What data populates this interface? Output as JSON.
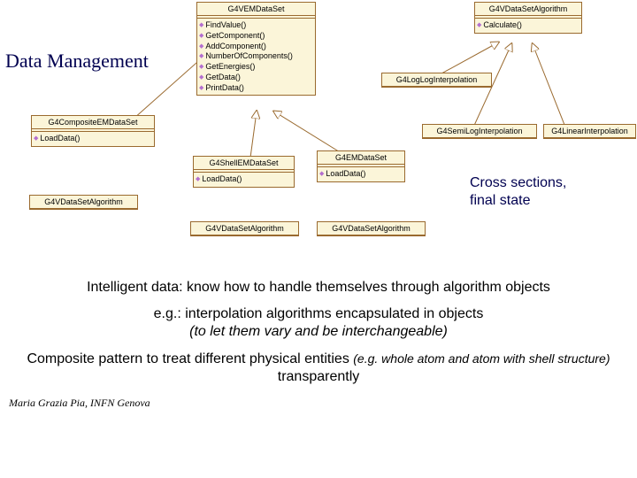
{
  "heading": "Data Management",
  "classes": {
    "vemdataset": {
      "title": "G4VEMDataSet",
      "methods": [
        "FindValue()",
        "GetComponent()",
        "AddComponent()",
        "NumberOfComponents()",
        "GetEnergies()",
        "GetData()",
        "PrintData()"
      ]
    },
    "vdatasetalgorithm": {
      "title": "G4VDataSetAlgorithm",
      "methods": [
        "Calculate()"
      ]
    },
    "loglog": {
      "title": "G4LogLogInterpolation"
    },
    "semilog": {
      "title": "G4SemiLogInterpolation"
    },
    "linear": {
      "title": "G4LinearInterpolation"
    },
    "composite": {
      "title": "G4CompositeEMDataSet",
      "methods": [
        "LoadData()"
      ]
    },
    "shell": {
      "title": "G4ShellEMDataSet",
      "methods": [
        "LoadData()"
      ]
    },
    "em": {
      "title": "G4EMDataSet",
      "methods": [
        "LoadData()"
      ]
    },
    "algref1": {
      "title": "G4VDataSetAlgorithm"
    },
    "algref2": {
      "title": "G4VDataSetAlgorithm"
    },
    "algref3": {
      "title": "G4VDataSetAlgorithm"
    }
  },
  "note_cross": {
    "line1": "Cross sections,",
    "line2": "final state"
  },
  "paragraphs": {
    "p1": "Intelligent data: know how to handle themselves through algorithm objects",
    "p2a": "e.g.: interpolation algorithms encapsulated in objects",
    "p2b": "(to let them vary and be interchangeable)",
    "p3a": "Composite pattern to treat different physical entities ",
    "p3b": "(e.g. whole atom and atom with shell structure)",
    "p3c": " transparently"
  },
  "footer": "Maria Grazia Pia, INFN Genova"
}
